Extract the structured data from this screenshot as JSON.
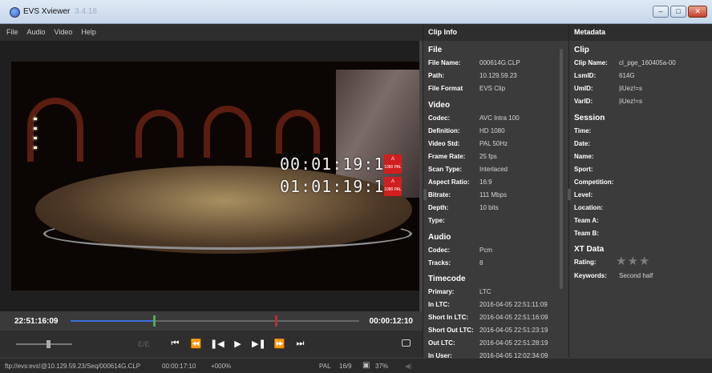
{
  "window": {
    "title": "EVS Xviewer",
    "version": "3.4.18"
  },
  "menu": [
    "File",
    "Audio",
    "Video",
    "Help"
  ],
  "video_overlay": {
    "tc1": "00:01:19:12",
    "tc2": "01:01:19:12",
    "badge_line1": "A",
    "badge_line2": "1080 PAL"
  },
  "timeline": {
    "current": "22:51:16:09",
    "duration": "00:00:12:10",
    "progress_fraction": 0.29
  },
  "transport": {
    "ee_label": "E/E"
  },
  "status": {
    "path": "ftp://evs:evs!@10.129.59.23/Seq/000614G.CLP",
    "time": "00:00:17:10",
    "speed": "+000%",
    "format": "PAL",
    "aspect": "16/9",
    "zoom": "37%"
  },
  "clip_info": {
    "title": "Clip Info",
    "file_section": "File",
    "file_name_label": "File Name:",
    "file_name": "000614G.CLP",
    "path_label": "Path:",
    "path": "10.129.59.23",
    "format_label": "File Format",
    "format": "EVS Clip",
    "video_section": "Video",
    "codec_label": "Codec:",
    "codec": "AVC Intra 100",
    "definition_label": "Definition:",
    "definition": "HD 1080",
    "std_label": "Video Std:",
    "std": "PAL 50Hz",
    "framerate_label": "Frame Rate:",
    "framerate": "25 fps",
    "scan_label": "Scan Type:",
    "scan": "Interlaced",
    "aspect_label": "Aspect Ratio:",
    "aspect": "16:9",
    "bitrate_label": "Bitrate:",
    "bitrate": "111 Mbps",
    "depth_label": "Depth:",
    "depth": "10 bits",
    "type_label": "Type:",
    "audio_section": "Audio",
    "a_codec_label": "Codec:",
    "a_codec": "Pcm",
    "tracks_label": "Tracks:",
    "tracks": "8",
    "tc_section": "Timecode",
    "primary_label": "Primary:",
    "primary": "LTC",
    "inltc_label": "In LTC:",
    "inltc": "2016-04-05 22:51:11:09",
    "shortin_label": "Short In LTC:",
    "shortin": "2016-04-05 22:51:16:09",
    "shortout_label": "Short Out LTC:",
    "shortout": "2016-04-05 22:51:23:19",
    "outltc_label": "Out LTC:",
    "outltc": "2016-04-05 22:51:28:19",
    "inuser_label": "In User:",
    "inuser": "2016-04-05 12:02:34:09"
  },
  "metadata": {
    "title": "Metadata",
    "clip_section": "Clip",
    "clipname_label": "Clip Name:",
    "clipname": "cl_pge_160405a-00",
    "lsmid_label": "LsmID:",
    "lsmid": "614G",
    "umid_label": "UmID:",
    "umid": "|iUez!=s",
    "varid_label": "VarID:",
    "varid": "|iUez!=s",
    "session_section": "Session",
    "time_label": "Time:",
    "date_label": "Date:",
    "name_label": "Name:",
    "sport_label": "Sport:",
    "competition_label": "Competition:",
    "level_label": "Level:",
    "location_label": "Location:",
    "teama_label": "Team A:",
    "teamb_label": "Team B:",
    "xt_section": "XT Data",
    "rating_label": "Rating:",
    "rating_value": 0,
    "rating_max": 3,
    "keywords_label": "Keywords:",
    "keywords": "Second half"
  },
  "colors": {
    "accent_played": "#3b6fd8",
    "playhead": "#4caf50",
    "mark": "#b43232",
    "close_button": "#c4402a"
  }
}
